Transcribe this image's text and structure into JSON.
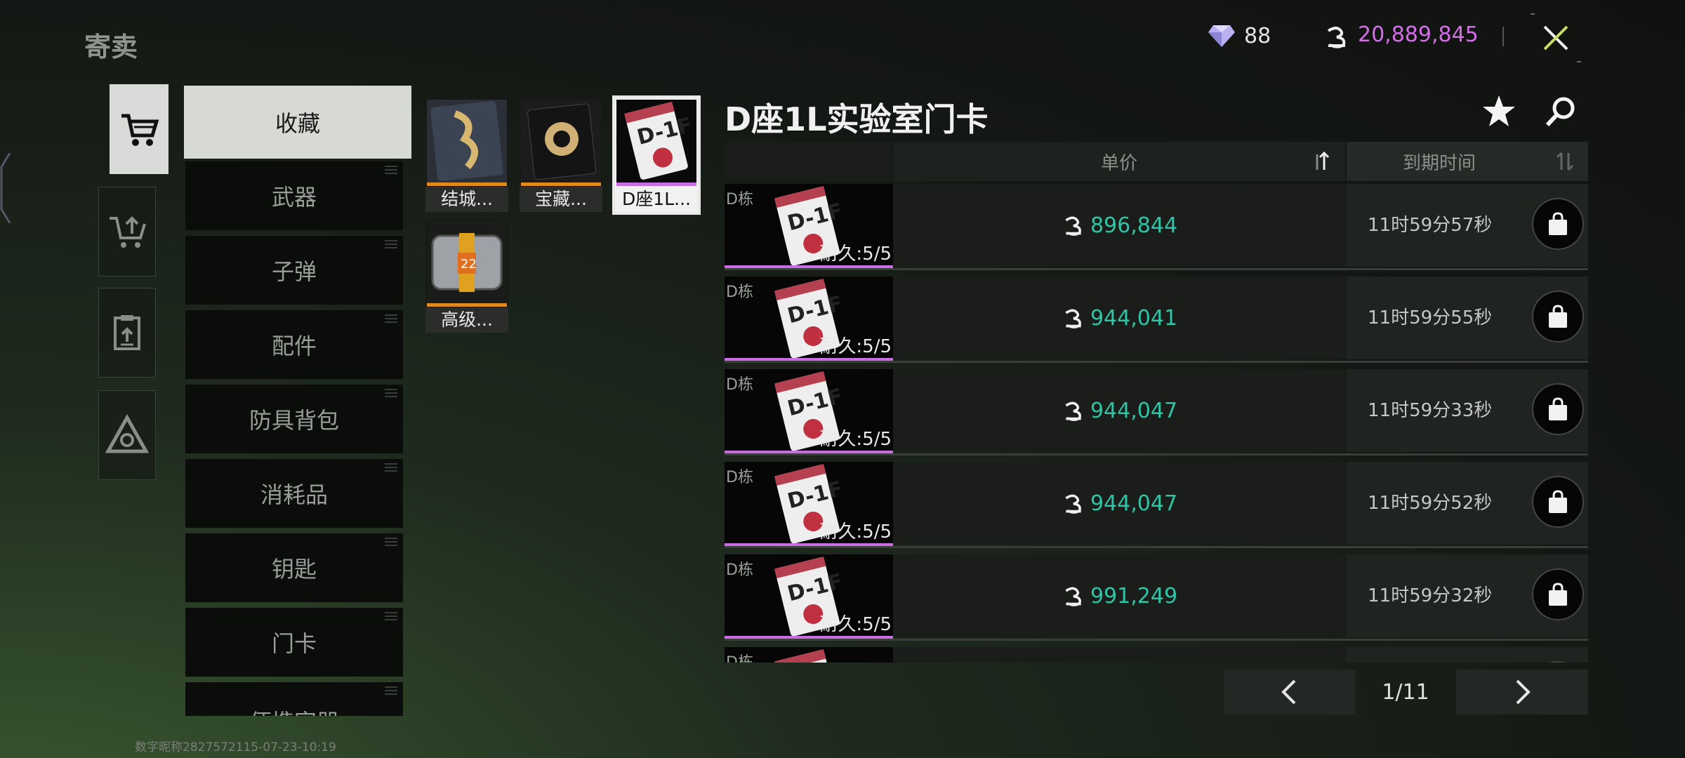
{
  "header": {
    "title": "寄卖",
    "gems": "88",
    "coins": "20,889,845",
    "accent_coin_color": "#d46ee8"
  },
  "side_tabs": [
    {
      "icon": "cart-icon",
      "active": true
    },
    {
      "icon": "cart-upload-icon",
      "active": false
    },
    {
      "icon": "clipboard-upload-icon",
      "active": false
    },
    {
      "icon": "triangle-logo-icon",
      "active": false
    }
  ],
  "categories": [
    {
      "label": "收藏",
      "active": true
    },
    {
      "label": "武器"
    },
    {
      "label": "子弹"
    },
    {
      "label": "配件"
    },
    {
      "label": "防具背包"
    },
    {
      "label": "消耗品"
    },
    {
      "label": "钥匙"
    },
    {
      "label": "门卡"
    },
    {
      "label": "便携容器"
    }
  ],
  "favorites": [
    {
      "label": "结城...",
      "bar_color": "#e0891c"
    },
    {
      "label": "宝藏...",
      "bar_color": "#e0891c"
    },
    {
      "label": "D座1L...",
      "bar_color": "#c86ee0",
      "selected": true
    },
    {
      "label": "高级...",
      "bar_color": "#e0891c"
    }
  ],
  "detail": {
    "item_name": "D座1L实验室门卡",
    "col_price": "单价",
    "col_expire": "到期时间"
  },
  "listings": [
    {
      "building": "D栋",
      "durability": "耐久:5/5",
      "price": "896,844",
      "expire": "11时59分57秒"
    },
    {
      "building": "D栋",
      "durability": "耐久:5/5",
      "price": "944,041",
      "expire": "11时59分55秒"
    },
    {
      "building": "D栋",
      "durability": "耐久:5/5",
      "price": "944,047",
      "expire": "11时59分33秒"
    },
    {
      "building": "D栋",
      "durability": "耐久:5/5",
      "price": "944,047",
      "expire": "11时59分52秒"
    },
    {
      "building": "D栋",
      "durability": "耐久:5/5",
      "price": "991,249",
      "expire": "11时59分32秒"
    },
    {
      "building": "D栋",
      "durability": "",
      "price": "",
      "expire": ""
    }
  ],
  "pagination": {
    "page": "1/11"
  },
  "watermark": "数字昵称2827572115-07-23-10:19",
  "colors": {
    "price_green": "#2ec5a6",
    "purple_rarity": "#c86ee0",
    "orange_rarity": "#e0891c"
  }
}
